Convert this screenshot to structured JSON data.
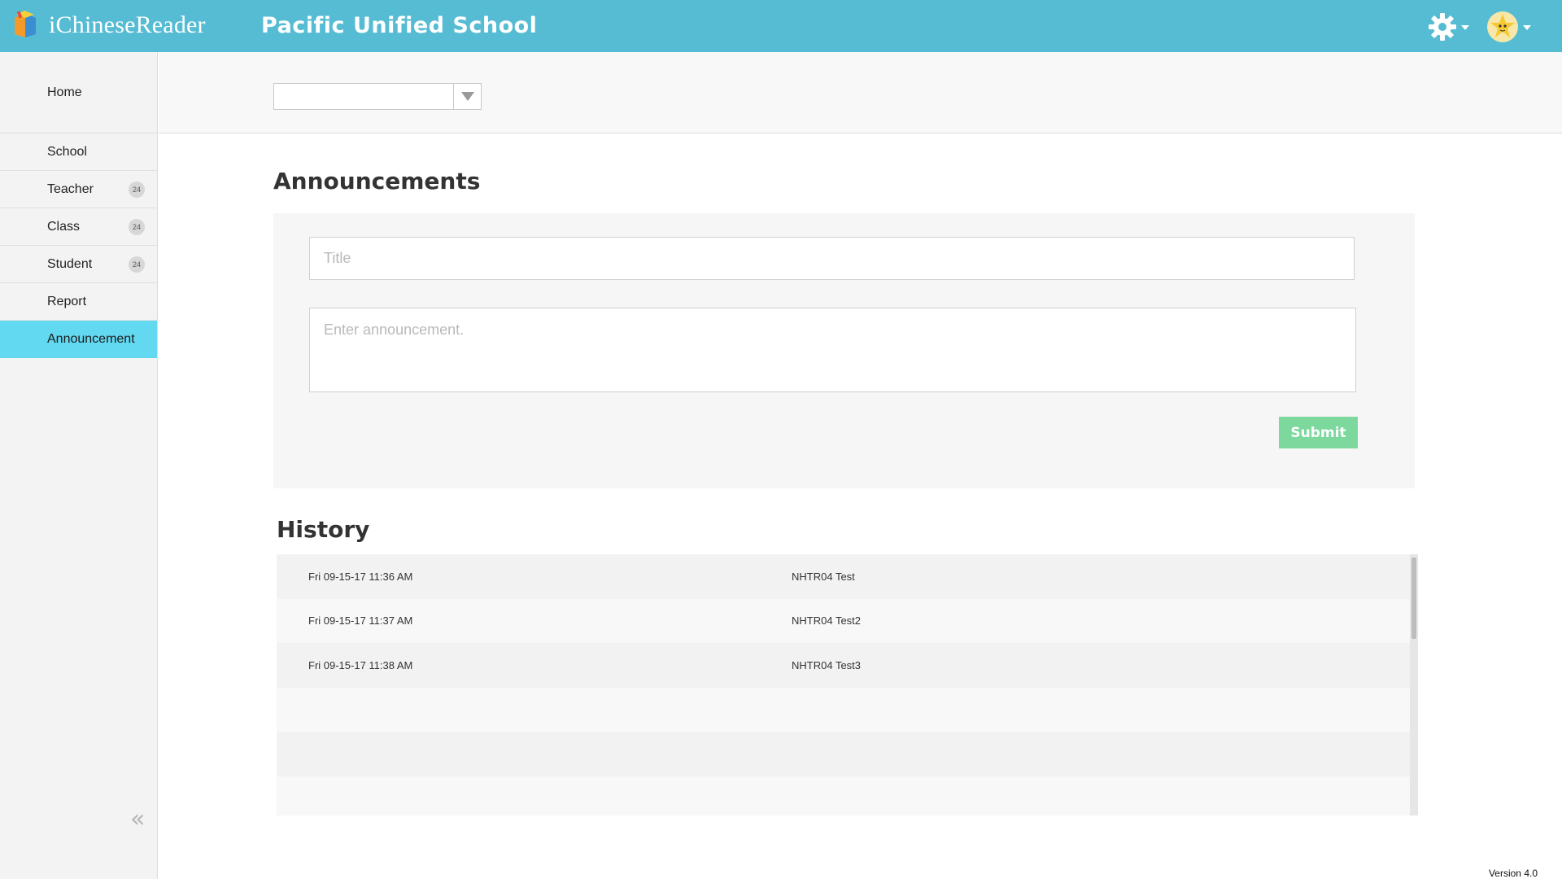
{
  "app": {
    "name": "iChineseReader",
    "school_name": "Pacific Unified School",
    "version": "Version 4.0"
  },
  "header": {
    "settings_icon": "gear-icon",
    "avatar_icon": "star-avatar-icon"
  },
  "sidebar": {
    "home_label": "Home",
    "items": [
      {
        "label": "School",
        "badge": ""
      },
      {
        "label": "Teacher",
        "badge": "24"
      },
      {
        "label": "Class",
        "badge": "24"
      },
      {
        "label": "Student",
        "badge": "24"
      },
      {
        "label": "Report",
        "badge": ""
      },
      {
        "label": "Announcement",
        "badge": "",
        "active": true
      }
    ],
    "collapse_glyph": "«"
  },
  "filter": {
    "selected_value": ""
  },
  "announcements": {
    "heading": "Announcements",
    "title_placeholder": "Title",
    "body_placeholder": "Enter announcement.",
    "submit_label": "Submit"
  },
  "history": {
    "heading": "History",
    "rows": [
      {
        "date": "Fri 09-15-17 11:36 AM",
        "title": "NHTR04 Test"
      },
      {
        "date": "Fri 09-15-17 11:37 AM",
        "title": "NHTR04 Test2"
      },
      {
        "date": "Fri 09-15-17 11:38 AM",
        "title": "NHTR04 Test3"
      },
      {
        "date": "",
        "title": ""
      },
      {
        "date": "",
        "title": ""
      },
      {
        "date": "",
        "title": ""
      }
    ]
  },
  "colors": {
    "header_bg": "#55bcd3",
    "active_nav": "#62d9f1",
    "submit_bg": "#7dd89e"
  }
}
